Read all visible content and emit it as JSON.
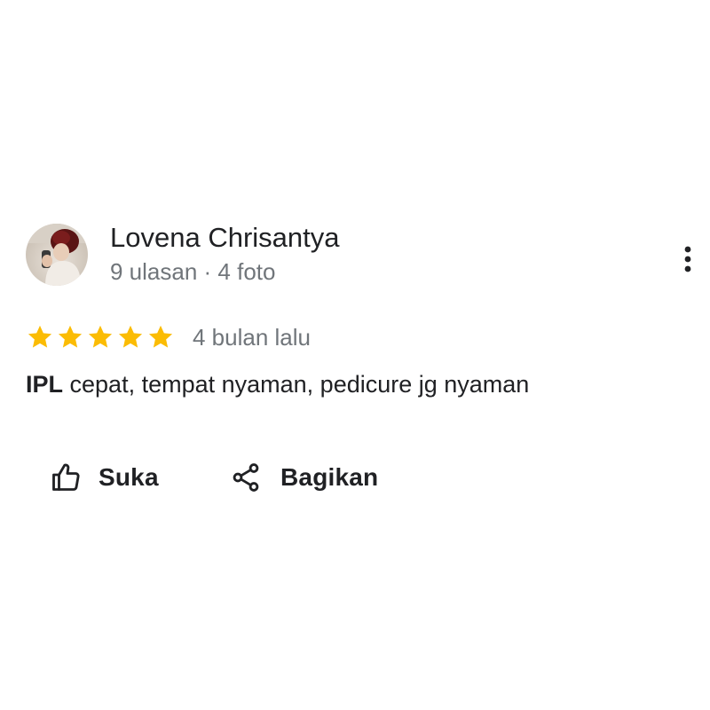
{
  "review": {
    "author": {
      "name": "Lovena Chrisantya",
      "meta": "9 ulasan · 4 foto",
      "avatar_icon": "profile-photo"
    },
    "rating": {
      "stars": 5,
      "max_stars": 5,
      "star_color": "#fbbc04",
      "time": "4 bulan lalu"
    },
    "text": {
      "keyword": "IPL",
      "body": " cepat, tempat nyaman, pedicure jg nyaman"
    },
    "actions": {
      "like_label": "Suka",
      "like_icon": "thumbs-up-icon",
      "share_label": "Bagikan",
      "share_icon": "share-icon"
    },
    "more_icon": "more-vertical-icon"
  }
}
